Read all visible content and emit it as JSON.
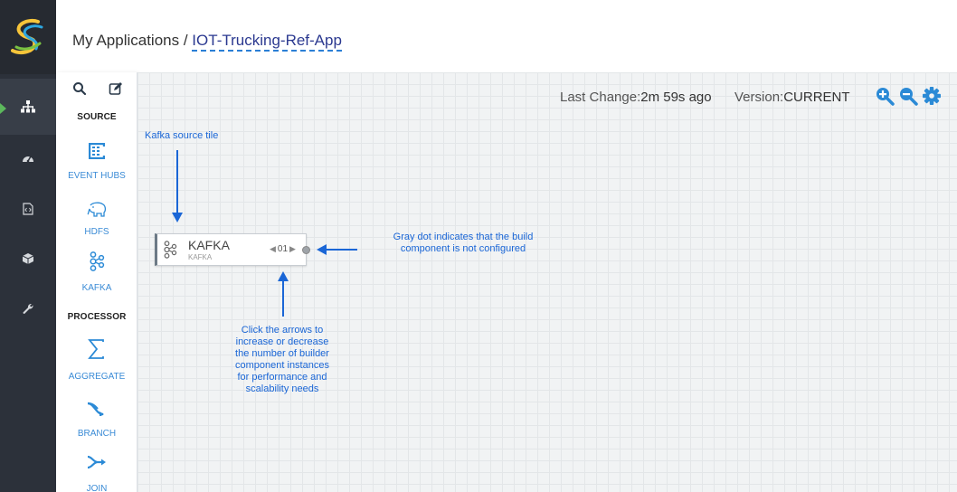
{
  "header": {
    "breadcrumb_root": "My Applications",
    "breadcrumb_sep": " / ",
    "app_name": "IOT-Trucking-Ref-App"
  },
  "sidebar": {
    "logo": "streaming-analytics-logo",
    "items": [
      {
        "icon": "topology-icon",
        "active": true
      },
      {
        "icon": "dashboard-icon",
        "active": false
      },
      {
        "icon": "code-file-icon",
        "active": false
      },
      {
        "icon": "package-icon",
        "active": false
      },
      {
        "icon": "wrench-icon",
        "active": false
      }
    ]
  },
  "palette": {
    "tools": [
      "search-icon",
      "edit-icon"
    ],
    "source_title": "SOURCE",
    "processor_title": "PROCESSOR",
    "sources": [
      {
        "label": "EVENT HUBS",
        "icon": "event-hubs-icon"
      },
      {
        "label": "HDFS",
        "icon": "hdfs-elephant-icon"
      },
      {
        "label": "KAFKA",
        "icon": "kafka-icon"
      }
    ],
    "processors": [
      {
        "label": "AGGREGATE",
        "icon": "sigma-icon"
      },
      {
        "label": "BRANCH",
        "icon": "branch-icon"
      },
      {
        "label": "JOIN",
        "icon": "join-icon"
      }
    ]
  },
  "canvas": {
    "last_change_label": "Last Change:",
    "last_change_value": "2m 59s ago",
    "version_label": "Version:",
    "version_value": "CURRENT",
    "zoom_tools": [
      "zoom-in-icon",
      "zoom-out-icon",
      "settings-icon"
    ],
    "component": {
      "title": "KAFKA",
      "subtitle": "KAFKA",
      "instances": "01",
      "configured": false
    },
    "annotations": {
      "kafka_tile": "Kafka source tile",
      "gray_dot": [
        "Gray dot indicates that the build",
        "component is not configured"
      ],
      "arrows": [
        "Click the arrows to",
        "increase or decrease",
        "the number of builder",
        "component instances",
        "for performance and",
        "scalability needs"
      ]
    }
  },
  "colors": {
    "sidebar": "#2c313a",
    "accent": "#3a8bd6",
    "annotation": "#1a66d6",
    "active_marker": "#5cb85c"
  }
}
